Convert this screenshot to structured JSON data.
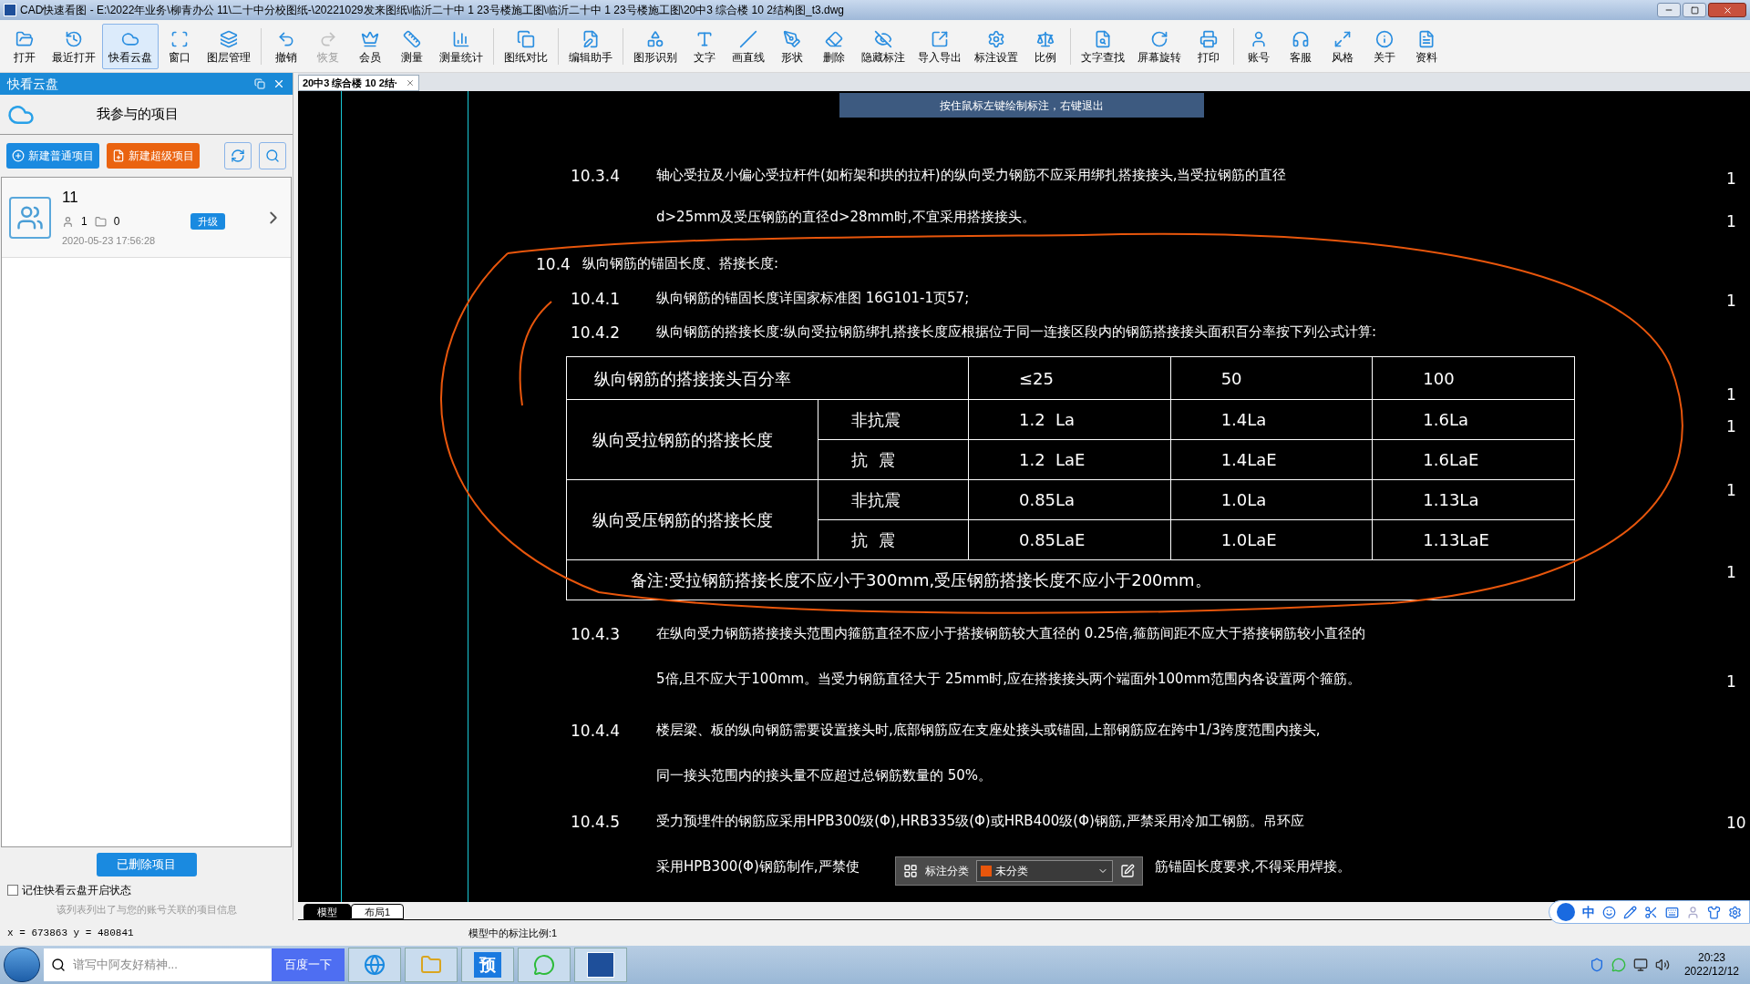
{
  "window": {
    "title": "CAD快速看图 - E:\\2022年业务\\柳青办公  11\\二十中分校图纸-\\20221029发来图纸\\临沂二十中    1 23号楼施工图\\临沂二十中    1 23号楼施工图\\20中3 综合楼 10 2结构图_t3.dwg"
  },
  "toolbar": [
    [
      {
        "label": "打开",
        "selected": false,
        "disabled": false
      },
      {
        "label": "最近打开",
        "selected": false,
        "disabled": false
      },
      {
        "label": "快看云盘",
        "selected": true,
        "disabled": false
      },
      {
        "label": "窗口",
        "selected": false,
        "disabled": false
      },
      {
        "label": "图层管理",
        "selected": false,
        "disabled": false
      }
    ],
    [
      {
        "label": "撤销",
        "selected": false,
        "disabled": false
      },
      {
        "label": "恢复",
        "selected": false,
        "disabled": true
      },
      {
        "label": "会员",
        "selected": false,
        "disabled": false
      },
      {
        "label": "测量",
        "selected": false,
        "disabled": false
      },
      {
        "label": "测量统计",
        "selected": false,
        "disabled": false
      }
    ],
    [
      {
        "label": "图纸对比",
        "selected": false,
        "disabled": false
      }
    ],
    [
      {
        "label": "编辑助手",
        "selected": false,
        "disabled": false
      }
    ],
    [
      {
        "label": "图形识别",
        "selected": false,
        "disabled": false
      },
      {
        "label": "文字",
        "selected": false,
        "disabled": false
      },
      {
        "label": "画直线",
        "selected": false,
        "disabled": false
      },
      {
        "label": "形状",
        "selected": false,
        "disabled": false
      },
      {
        "label": "删除",
        "selected": false,
        "disabled": false
      },
      {
        "label": "隐藏标注",
        "selected": false,
        "disabled": false
      },
      {
        "label": "导入导出",
        "selected": false,
        "disabled": false
      },
      {
        "label": "标注设置",
        "selected": false,
        "disabled": false
      },
      {
        "label": "比例",
        "selected": false,
        "disabled": false
      }
    ],
    [
      {
        "label": "文字查找",
        "selected": false,
        "disabled": false
      },
      {
        "label": "屏幕旋转",
        "selected": false,
        "disabled": false
      },
      {
        "label": "打印",
        "selected": false,
        "disabled": false
      }
    ],
    [
      {
        "label": "账号",
        "selected": false,
        "disabled": false
      },
      {
        "label": "客服",
        "selected": false,
        "disabled": false
      },
      {
        "label": "风格",
        "selected": false,
        "disabled": false
      },
      {
        "label": "关于",
        "selected": false,
        "disabled": false
      },
      {
        "label": "资料",
        "selected": false,
        "disabled": false
      }
    ]
  ],
  "cloud_panel": {
    "title": "快看云盘",
    "heading": "我参与的项目",
    "buttons": [
      "新建普通项目",
      "新建超级项目"
    ],
    "projects": [
      {
        "name": "11",
        "members": "1",
        "files": "0",
        "badge": "升级",
        "date": "2020-05-23 17:56:28"
      }
    ],
    "deleted_button": "已删除项目",
    "remember": {
      "label": "记住快看云盘开启状态",
      "checked": false
    },
    "hint": "该列表列出了与您的账号关联的项目信息"
  },
  "document_tab": {
    "label": "20中3 综合楼 10 2结·"
  },
  "drawing": {
    "hint": "按住鼠标左键绘制标注，右键退出",
    "paragraphs": [
      {
        "number": "10.3.4",
        "lines": [
          "轴心受拉及小偏心受拉杆件(如桁架和拱的拉杆)的纵向受力钢筋不应采用绑扎搭接接头,当受拉钢筋的直径",
          "d>25mm及受压钢筋的直径d>28mm时,不宜采用搭接接头。"
        ]
      },
      {
        "number": "10.4",
        "lines": [
          "纵向钢筋的锚固长度、搭接长度:"
        ]
      },
      {
        "number": "10.4.1",
        "lines": [
          "纵向钢筋的锚固长度详国家标准图 16G101-1页57;"
        ]
      },
      {
        "number": "10.4.2",
        "lines": [
          "纵向钢筋的搭接长度:纵向受拉钢筋绑扎搭接长度应根据位于同一连接区段内的钢筋搭接接头面积百分率按下列公式计算:"
        ]
      }
    ],
    "table": {
      "header": [
        "纵向钢筋的搭接接头百分率",
        "≤25",
        "50",
        "100"
      ],
      "groups": [
        {
          "label": "纵向受拉钢筋的搭接长度",
          "rows": [
            {
              "type": "非抗震",
              "values": [
                "1.2  La",
                "1.4La",
                "1.6La"
              ]
            },
            {
              "type": "抗  震",
              "values": [
                "1.2  LaE",
                "1.4LaE",
                "1.6LaE"
              ]
            }
          ]
        },
        {
          "label": "纵向受压钢筋的搭接长度",
          "rows": [
            {
              "type": "非抗震",
              "values": [
                "0.85La",
                "1.0La",
                "1.13La"
              ]
            },
            {
              "type": "抗  震",
              "values": [
                "0.85LaE",
                "1.0LaE",
                "1.13LaE"
              ]
            }
          ]
        }
      ],
      "note": "备注:受拉钢筋搭接长度不应小于300mm,受压钢筋搭接长度不应小于200mm。"
    },
    "paragraphs_after": [
      {
        "number": "10.4.3",
        "lines": [
          "在纵向受力钢筋搭接接头范围内箍筋直径不应小于搭接钢筋较大直径的 0.25倍,箍筋间距不应大于搭接钢筋较小直径的",
          "5倍,且不应大于100mm。当受力钢筋直径大于 25mm时,应在搭接接头两个端面外100mm范围内各设置两个箍筋。"
        ]
      },
      {
        "number": "10.4.4",
        "lines": [
          "楼层梁、板的纵向钢筋需要设置接头时,底部钢筋应在支座处接头或锚固,上部钢筋应在跨中1/3跨度范围内接头,",
          "同一接头范围内的接头量不应超过总钢筋数量的 50%。"
        ]
      },
      {
        "number": "10.4.5",
        "lines": [
          "受力预埋件的钢筋应采用HPB300级(Φ),HRB335级(Φ)或HRB400级(Φ)钢筋,严禁采用冷加工钢筋。吊环应",
          "采用HPB300(Φ)钢筋制作,严禁使"
        ],
        "visible_tail": "筋锚固长度要求,不得采用焊接。"
      }
    ],
    "edge_marks": [
      "1",
      "1",
      "1",
      "1",
      "1",
      "1",
      "1",
      "1",
      "10"
    ]
  },
  "annotation_bar": {
    "label": "标注分类",
    "category": "未分类",
    "color": "#e8560c"
  },
  "layout_tabs": [
    {
      "label": "模型",
      "selected": true
    },
    {
      "label": "布局1",
      "selected": false
    }
  ],
  "status_bar": {
    "coords": "x = 673863 y = 480841",
    "scale": "模型中的标注比例:1"
  },
  "ime_bar": {
    "mode": "中"
  },
  "taskbar": {
    "search_placeholder": "谱写中阿友好精神...",
    "search_button": "百度一下",
    "apps": [
      "预"
    ],
    "time": "20:23",
    "date": "2022/12/12"
  }
}
